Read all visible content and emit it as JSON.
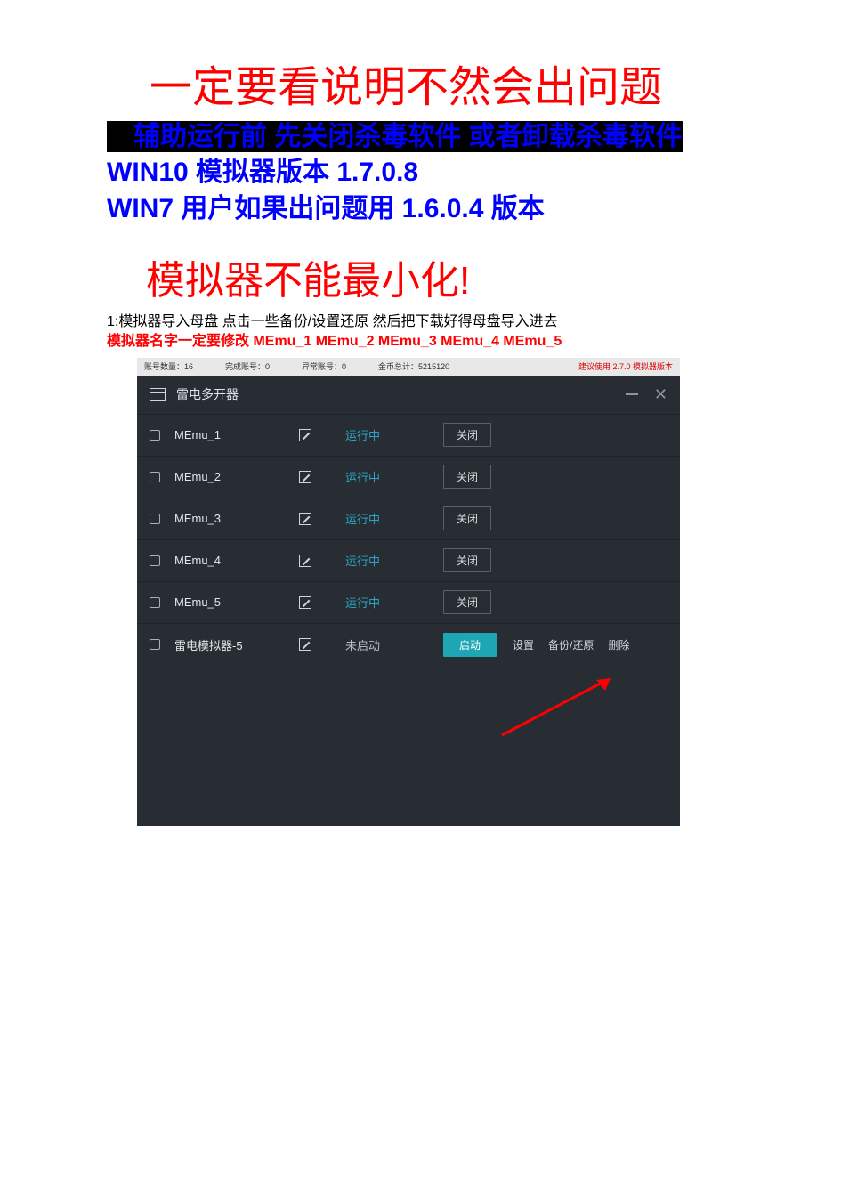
{
  "doc": {
    "heading_red_1": "一定要看说明不然会出问题",
    "blue_highlight": "辅助运行前 先关闭杀毒软件 或者卸载杀毒软件",
    "blue_line_1": "WIN10 模拟器版本 1.7.0.8",
    "blue_line_2": "WIN7 用户如果出问题用 1.6.0.4 版本",
    "heading_red_2": "模拟器不能最小化!",
    "step_black": "1:模拟器导入母盘 点击一些备份/设置还原 然后把下载好得母盘导入进去",
    "step_red": "模拟器名字一定要修改 MEmu_1 MEmu_2 MEmu_3 MEmu_4 MEmu_5"
  },
  "topbar": {
    "accounts": "账号数量：16",
    "done": "完成账号：0",
    "error": "异常账号：0",
    "gold": "金币总计：5215120",
    "tip": "建议使用 2.7.0 模拟器版本"
  },
  "app": {
    "title": "雷电多开器",
    "rows": [
      {
        "name": "MEmu_1",
        "status": "运行中",
        "statusType": "running",
        "btn": "关闭",
        "btnType": "close"
      },
      {
        "name": "MEmu_2",
        "status": "运行中",
        "statusType": "running",
        "btn": "关闭",
        "btnType": "close"
      },
      {
        "name": "MEmu_3",
        "status": "运行中",
        "statusType": "running",
        "btn": "关闭",
        "btnType": "close"
      },
      {
        "name": "MEmu_4",
        "status": "运行中",
        "statusType": "running",
        "btn": "关闭",
        "btnType": "close"
      },
      {
        "name": "MEmu_5",
        "status": "运行中",
        "statusType": "running",
        "btn": "关闭",
        "btnType": "close"
      },
      {
        "name": "雷电模拟器-5",
        "status": "未启动",
        "statusType": "stopped",
        "btn": "启动",
        "btnType": "start"
      }
    ],
    "extra": {
      "settings": "设置",
      "backup": "备份/还原",
      "delete": "删除"
    }
  }
}
